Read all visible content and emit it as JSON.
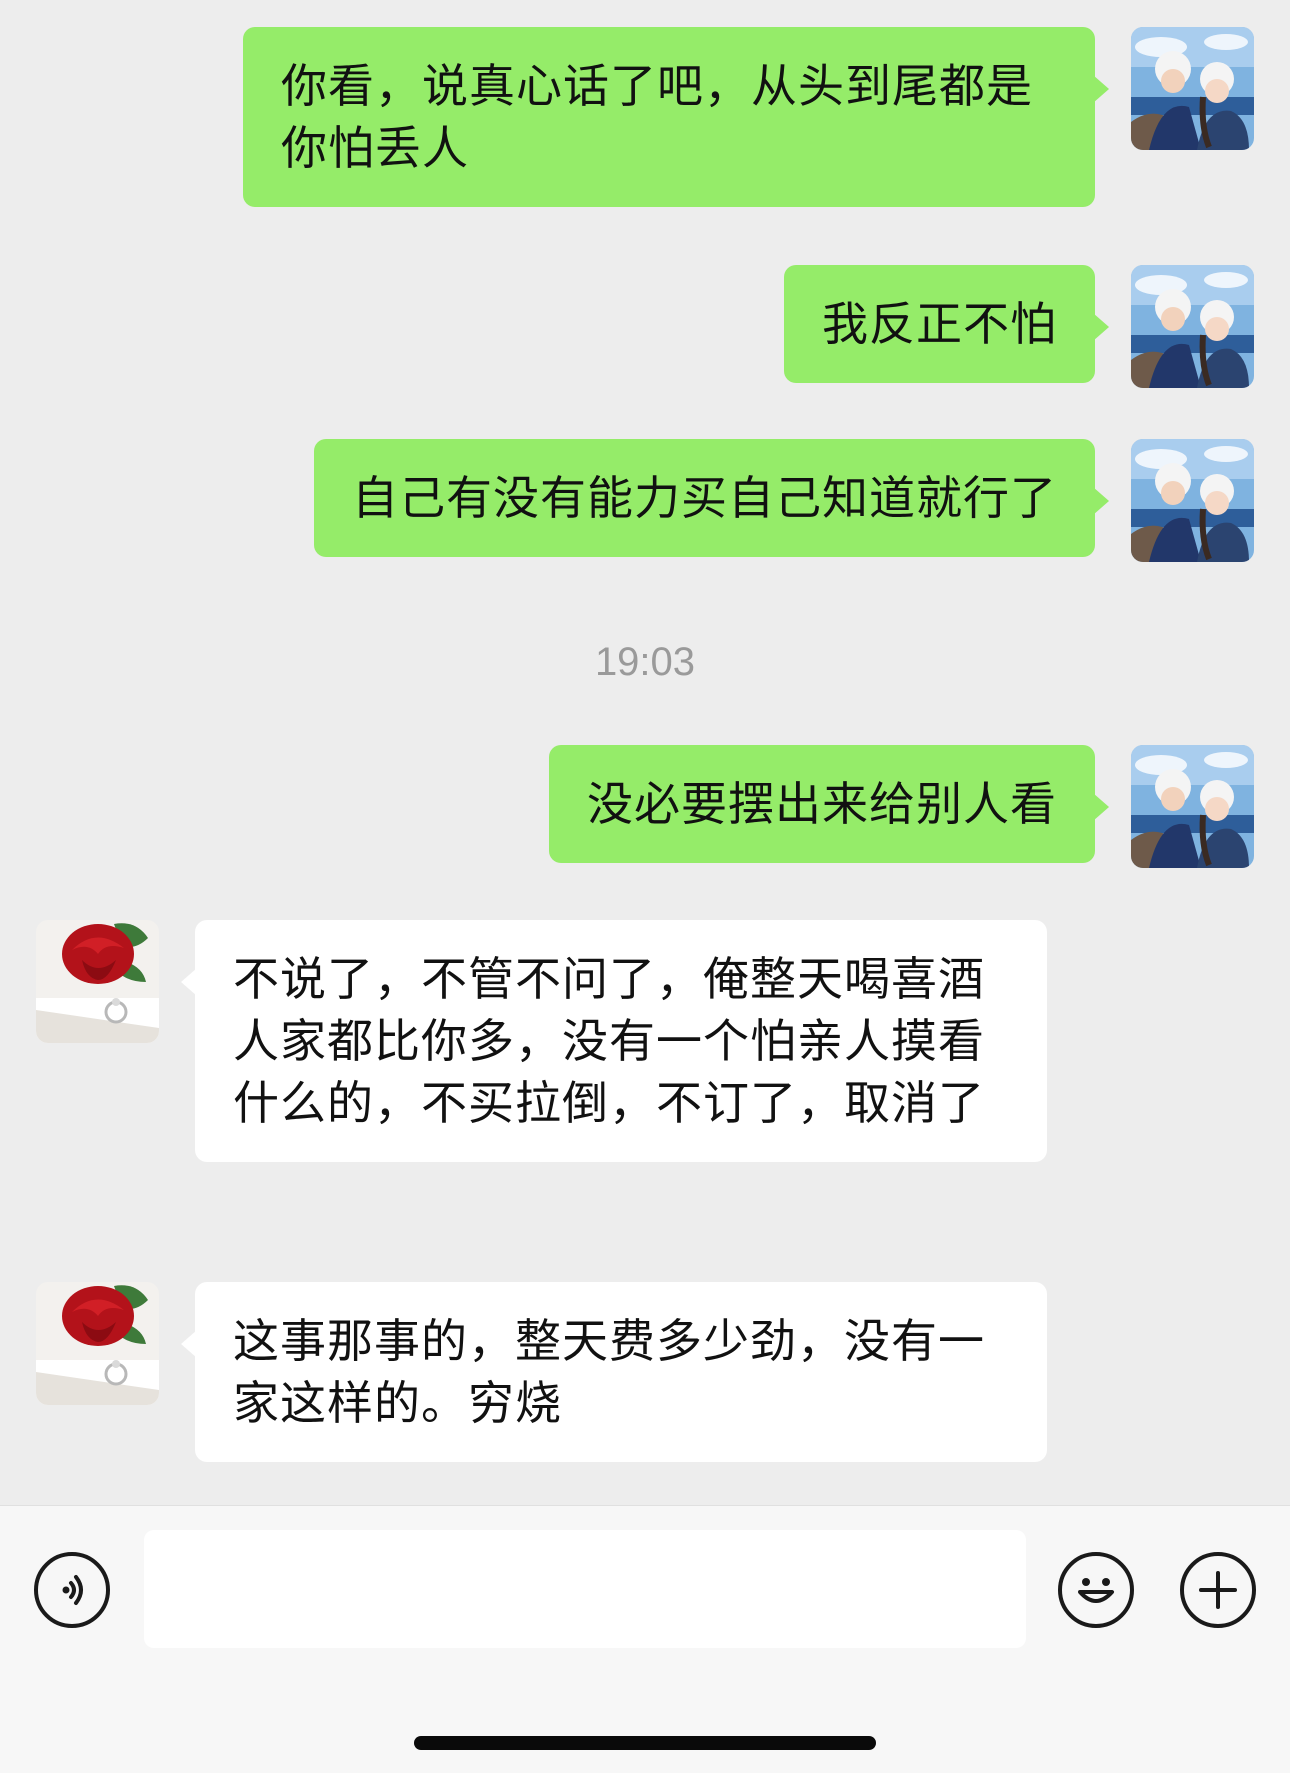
{
  "chat": {
    "messages": [
      {
        "sender": "self",
        "text": "你看，说真心话了吧，从头到尾都是你怕丢人"
      },
      {
        "sender": "self",
        "text": "我反正不怕"
      },
      {
        "sender": "self",
        "text": "自己有没有能力买自己知道就行了"
      },
      {
        "type": "timestamp",
        "text": "19:03"
      },
      {
        "sender": "self",
        "text": "没必要摆出来给别人看"
      },
      {
        "sender": "other",
        "text": "不说了，不管不问了，俺整天喝喜酒人家都比你多，没有一个怕亲人摸看什么的，不买拉倒，不订了，取消了"
      },
      {
        "sender": "other",
        "text": "这事那事的，整天费多少劲，没有一家这样的。穷烧"
      }
    ]
  },
  "input_bar": {
    "voice_icon": "voice-icon",
    "text_value": "",
    "emoji_icon": "emoji-icon",
    "plus_icon": "plus-icon"
  },
  "colors": {
    "background": "#EDEDED",
    "self_bubble": "#95EC69",
    "other_bubble": "#FFFFFF",
    "timestamp": "#9A9A9A"
  }
}
